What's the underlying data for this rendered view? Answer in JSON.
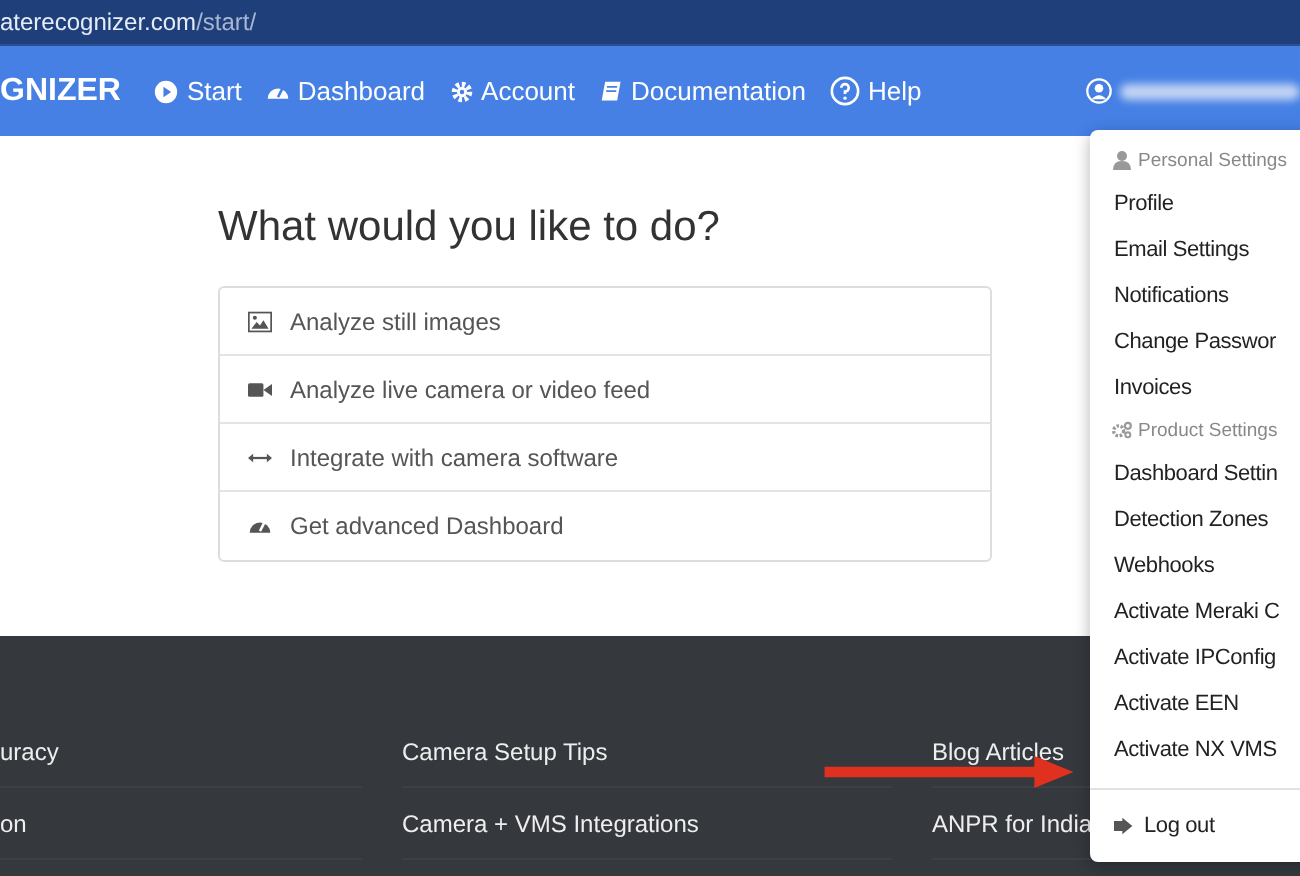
{
  "address_bar": {
    "host": "aterecognizer.com",
    "path": "/start/"
  },
  "navbar": {
    "brand": "GNIZER",
    "items": [
      {
        "label": "Start"
      },
      {
        "label": "Dashboard"
      },
      {
        "label": "Account"
      },
      {
        "label": "Documentation"
      },
      {
        "label": "Help"
      }
    ]
  },
  "main": {
    "heading": "What would you like to do?",
    "options": [
      {
        "label": "Analyze still images"
      },
      {
        "label": "Analyze live camera or video feed"
      },
      {
        "label": "Integrate with camera software"
      },
      {
        "label": "Get advanced Dashboard"
      }
    ]
  },
  "footer": {
    "columns": [
      [
        "uracy",
        "on"
      ],
      [
        "Camera Setup Tips",
        "Camera + VMS Integrations"
      ],
      [
        "Blog Articles",
        "ANPR for India"
      ]
    ]
  },
  "user_menu": {
    "items": [
      {
        "kind": "header",
        "label": "Personal Settings"
      },
      {
        "kind": "link",
        "label": "Profile"
      },
      {
        "kind": "link",
        "label": "Email Settings"
      },
      {
        "kind": "link",
        "label": "Notifications"
      },
      {
        "kind": "link",
        "label": "Change Passwor"
      },
      {
        "kind": "link",
        "label": "Invoices"
      },
      {
        "kind": "header",
        "label": "Product Settings"
      },
      {
        "kind": "link",
        "label": "Dashboard Settin"
      },
      {
        "kind": "link",
        "label": "Detection Zones"
      },
      {
        "kind": "link",
        "label": "Webhooks"
      },
      {
        "kind": "link",
        "label": "Activate Meraki C"
      },
      {
        "kind": "link",
        "label": "Activate IPConfig"
      },
      {
        "kind": "link",
        "label": "Activate EEN"
      },
      {
        "kind": "link",
        "label": "Activate NX VMS"
      },
      {
        "kind": "divider"
      },
      {
        "kind": "logout",
        "label": "Log out"
      }
    ]
  }
}
